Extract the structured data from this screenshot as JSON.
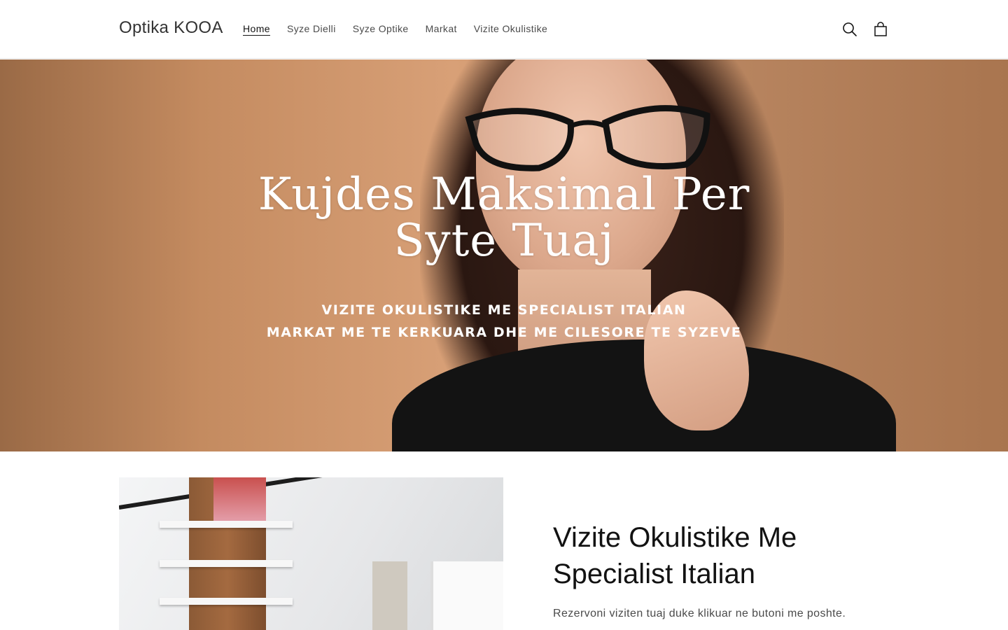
{
  "header": {
    "logo": "Optika KOOA",
    "nav": [
      {
        "label": "Home",
        "active": true
      },
      {
        "label": "Syze Dielli",
        "active": false
      },
      {
        "label": "Syze Optike",
        "active": false
      },
      {
        "label": "Markat",
        "active": false
      },
      {
        "label": "Vizite Okulistike",
        "active": false
      }
    ],
    "icons": [
      "search-icon",
      "cart-icon"
    ]
  },
  "hero": {
    "title_line1": "Kujdes Maksimal Per",
    "title_line2": "Syte Tuaj",
    "subtitle_line1": "VIZITE OKULISTIKE ME SPECIALIST ITALIAN",
    "subtitle_line2": "MARKAT ME TE KERKUARA DHE ME CILESORE TE SYZEVE"
  },
  "info": {
    "title": "Vizite Okulistike Me Specialist Italian",
    "text": "Rezervoni viziten tuaj duke klikuar ne butoni me poshte."
  },
  "colors": {
    "text": "#121212",
    "muted": "#4a4a4a",
    "hero_bg": "#c48b60"
  }
}
